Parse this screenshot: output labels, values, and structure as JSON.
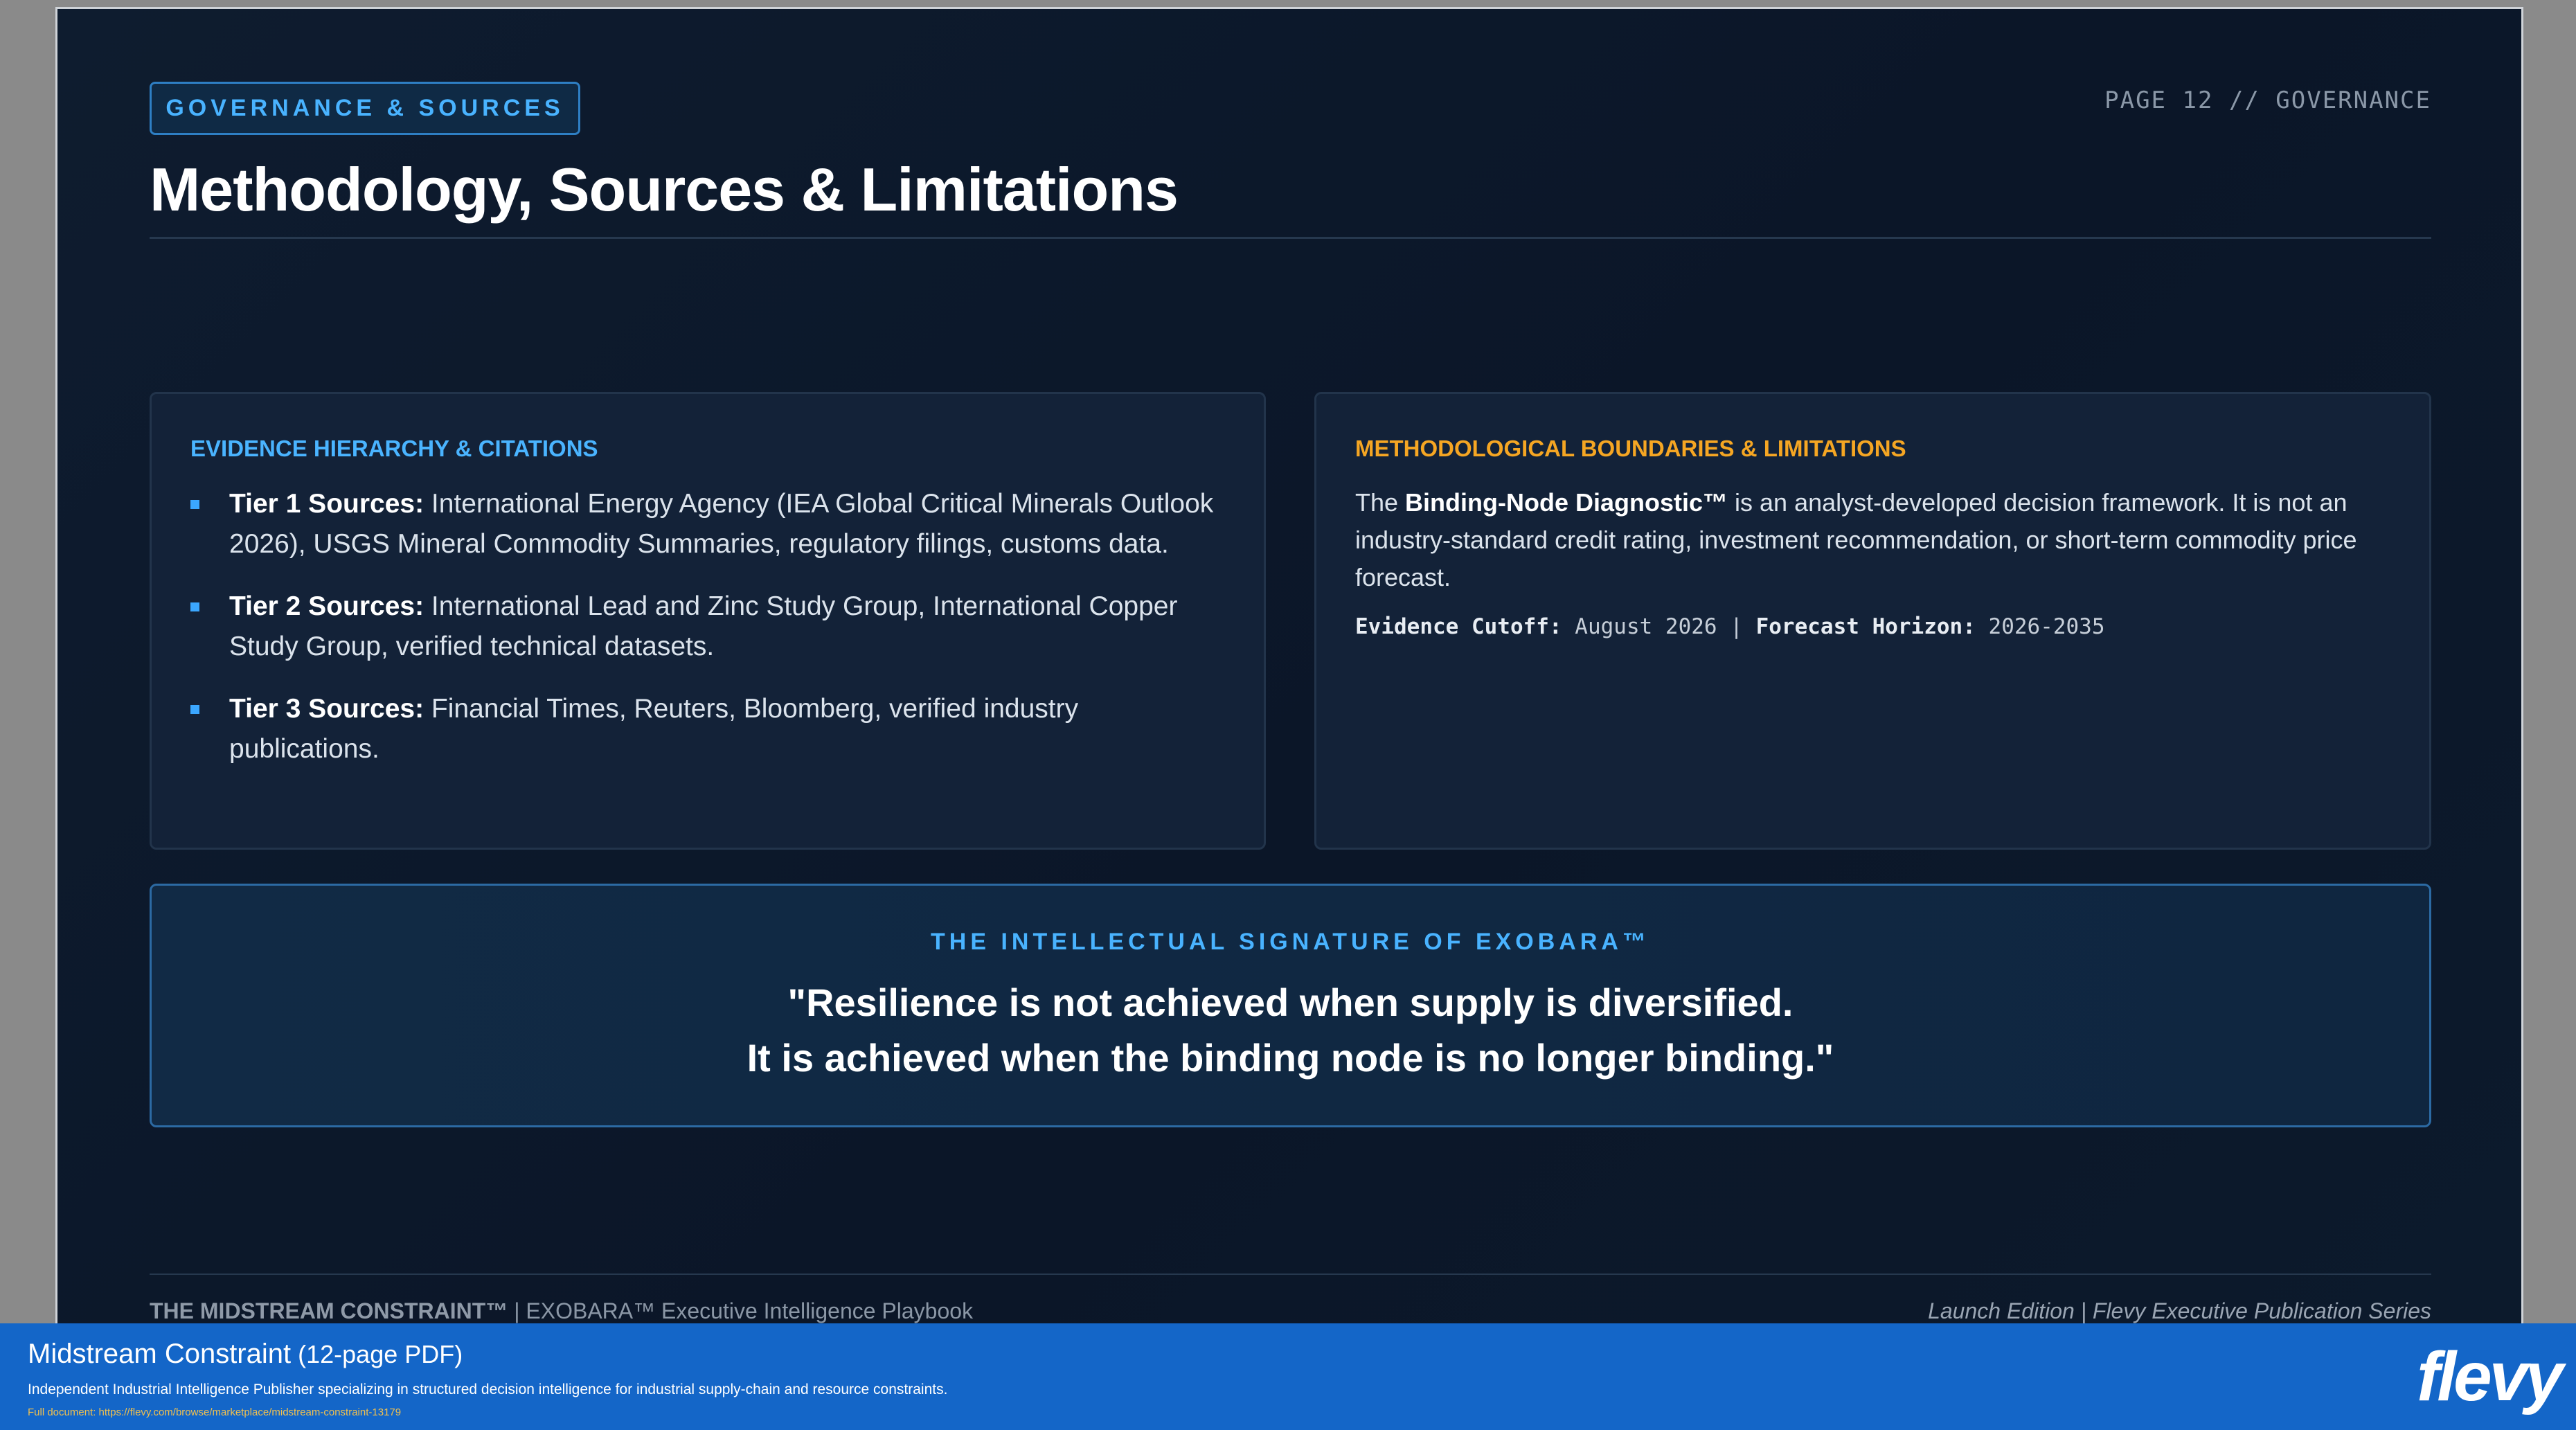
{
  "slide": {
    "tag": "GOVERNANCE & SOURCES",
    "page_label": "PAGE 12 // GOVERNANCE",
    "title": "Methodology, Sources & Limitations",
    "evidence": {
      "heading": "EVIDENCE HIERARCHY & CITATIONS",
      "tiers": [
        {
          "label": "Tier 1 Sources:",
          "text": " International Energy Agency (IEA Global Critical Minerals Outlook 2026), USGS Mineral Commodity Summaries, regulatory filings, customs data."
        },
        {
          "label": "Tier 2 Sources:",
          "text": " International Lead and Zinc Study Group, International Copper Study Group, verified technical datasets."
        },
        {
          "label": "Tier 3 Sources:",
          "text": " Financial Times, Reuters, Bloomberg, verified industry publications."
        }
      ]
    },
    "limitations": {
      "heading": "METHODOLOGICAL BOUNDARIES & LIMITATIONS",
      "para_pre": "The ",
      "para_bold": "Binding-Node Diagnostic™",
      "para_post": " is an analyst-developed decision framework. It is not an industry-standard credit rating, investment recommendation, or short-term commodity price forecast.",
      "cutoff_label": "Evidence Cutoff:",
      "cutoff_value": " August 2026 | ",
      "horizon_label": "Forecast Horizon:",
      "horizon_value": " 2026-2035"
    },
    "signature": {
      "heading": "THE INTELLECTUAL SIGNATURE OF EXOBARA™",
      "line1": "\"Resilience is not achieved when supply is diversified.",
      "line2": "It is achieved when the binding node is no longer binding.\""
    },
    "footer": {
      "left_bold": "THE MIDSTREAM CONSTRAINT™",
      "left_rest": " | EXOBARA™ Executive Intelligence Playbook",
      "right": "Launch Edition | Flevy Executive Publication Series"
    }
  },
  "banner": {
    "title": "Midstream Constraint",
    "subtitle": " (12-page PDF)",
    "description": "Independent Industrial Intelligence Publisher specializing in structured decision intelligence for industrial supply-chain and resource constraints.",
    "link": "Full document: https://flevy.com/browse/marketplace/midstream-constraint-13179",
    "logo": "flevy"
  }
}
